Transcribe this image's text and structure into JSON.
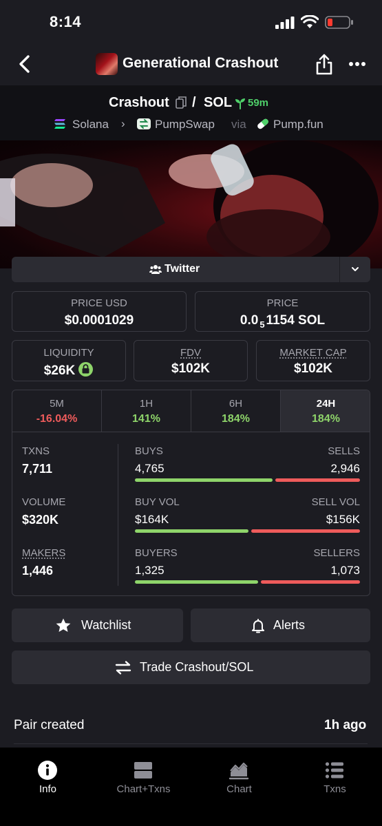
{
  "status_bar": {
    "time": "8:14"
  },
  "header": {
    "title": "Generational Crashout"
  },
  "pair": {
    "base": "Crashout",
    "separator": "/",
    "quote": "SOL",
    "age": "59m",
    "chain": "Solana",
    "dex": "PumpSwap",
    "via": "via",
    "launchpad": "Pump.fun"
  },
  "social": {
    "label": "Twitter"
  },
  "price": {
    "usd_label": "PRICE USD",
    "usd_value": "$0.0001029",
    "native_label": "PRICE",
    "native_prefix": "0.0",
    "native_zeros": "5",
    "native_digits": "1154 SOL"
  },
  "metrics": {
    "liquidity_label": "LIQUIDITY",
    "liquidity_value": "$26K",
    "fdv_label": "FDV",
    "fdv_value": "$102K",
    "mcap_label": "MARKET CAP",
    "mcap_value": "$102K"
  },
  "timeframes": [
    {
      "label": "5M",
      "value": "-16.04%",
      "color": "#ee5b5b"
    },
    {
      "label": "1H",
      "value": "141%",
      "color": "#8ed46a"
    },
    {
      "label": "6H",
      "value": "184%",
      "color": "#8ed46a"
    },
    {
      "label": "24H",
      "value": "184%",
      "color": "#8ed46a",
      "active": true
    }
  ],
  "stats": {
    "txns_label": "TXNS",
    "txns_value": "7,711",
    "buys_label": "BUYS",
    "buys_value": "4,765",
    "sells_label": "SELLS",
    "sells_value": "2,946",
    "volume_label": "VOLUME",
    "volume_value": "$320K",
    "buy_vol_label": "BUY VOL",
    "buy_vol_value": "$164K",
    "sell_vol_label": "SELL VOL",
    "sell_vol_value": "$156K",
    "makers_label": "MAKERS",
    "makers_value": "1,446",
    "buyers_label": "BUYERS",
    "buyers_value": "1,325",
    "sellers_label": "SELLERS",
    "sellers_value": "1,073",
    "buy_ratio_txns": 0.618,
    "buy_ratio_vol": 0.512,
    "buy_ratio_makers": 0.553
  },
  "actions": {
    "watchlist": "Watchlist",
    "alerts": "Alerts",
    "trade": "Trade Crashout/SOL"
  },
  "info": {
    "pair_created_label": "Pair created",
    "pair_created_value": "1h ago"
  },
  "bottom_nav": [
    {
      "label": "Info",
      "icon": "info-icon",
      "active": true
    },
    {
      "label": "Chart+Txns",
      "icon": "chart-txns-icon"
    },
    {
      "label": "Chart",
      "icon": "chart-icon"
    },
    {
      "label": "Txns",
      "icon": "list-icon"
    }
  ]
}
